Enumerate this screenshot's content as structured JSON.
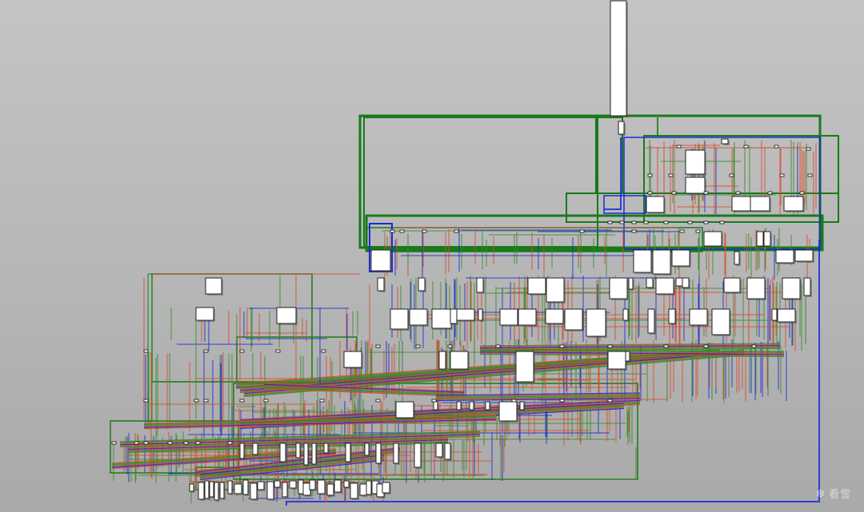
{
  "colors": {
    "background": "#b8b8b8",
    "boxFill": "#ffffff",
    "boxStroke": "#222222",
    "groupGreen": "#187a18",
    "linkRed": "#d84a2a",
    "linkGreen": "#3a8a2a",
    "linkBlue": "#1a2ad8"
  },
  "watermark": {
    "icon": "snowflake-icon",
    "text": "看雪"
  }
}
